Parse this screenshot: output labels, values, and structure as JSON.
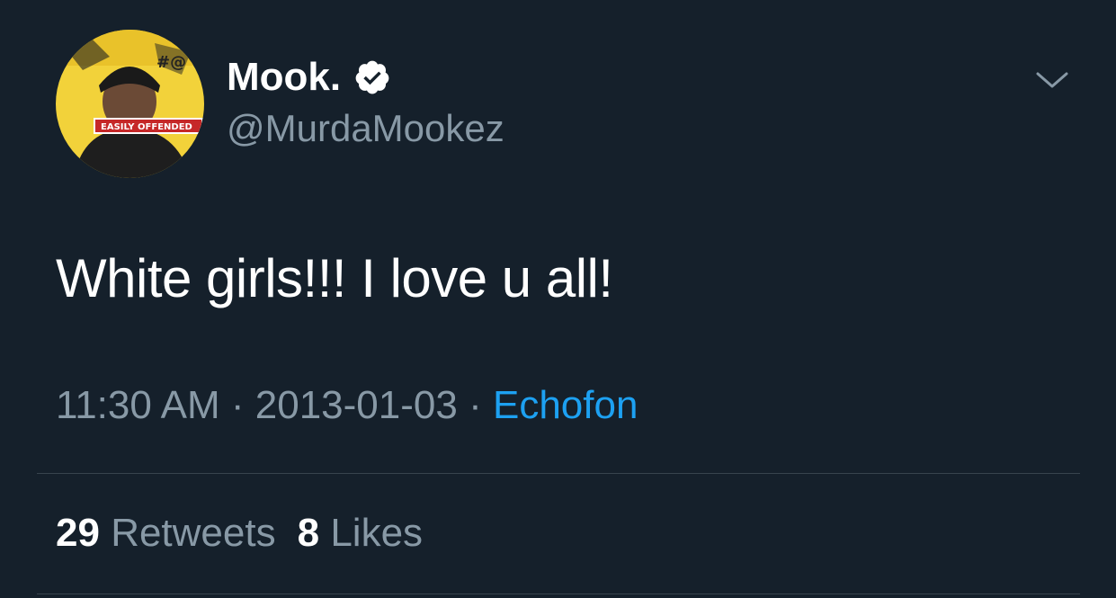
{
  "user": {
    "display_name": "Mook.",
    "handle": "@MurdaMookez",
    "avatar_badge_text": "EASILY OFFENDED",
    "verified": true
  },
  "tweet": {
    "text": "White girls!!! I love u all!",
    "time": "11:30 AM",
    "separator1": "·",
    "date": "2013-01-03",
    "separator2": "·",
    "source": "Echofon"
  },
  "stats": {
    "retweets_count": "29",
    "retweets_label": "Retweets",
    "likes_count": "8",
    "likes_label": "Likes"
  },
  "colors": {
    "background": "#15202b",
    "text_primary": "#ffffff",
    "text_secondary": "#8899a6",
    "link": "#1da1f2",
    "divider": "#38444d"
  }
}
